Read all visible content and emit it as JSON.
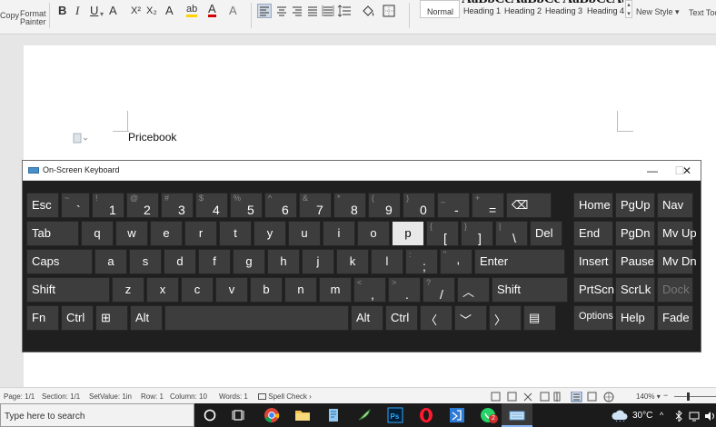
{
  "ribbon": {
    "copy": "Copy",
    "format_painter_1": "Format",
    "format_painter_2": "Painter",
    "fmt_bold": "B",
    "fmt_italic": "I",
    "fmt_underline": "U",
    "fmt_sub": "X₂",
    "fmt_sup": "X²",
    "fmt_font_color": "A",
    "styles": [
      "Normal",
      "Heading 1",
      "Heading 2",
      "Heading 3",
      "Heading 4"
    ],
    "styles_preview": "AaBbCcAaBbCc AaBbCcAaBbCc",
    "new_style": "New Style",
    "text_tool": "Text Too"
  },
  "document": {
    "text": "Pricebook"
  },
  "osk": {
    "title": "On-Screen Keyboard",
    "minimize": "—",
    "maximize": "☐",
    "close": "✕",
    "row1": [
      {
        "id": "esc",
        "main": "Esc"
      },
      {
        "id": "grave",
        "up": "~",
        "lo": "`"
      },
      {
        "id": "1",
        "up": "!",
        "lo": "1"
      },
      {
        "id": "2",
        "up": "@",
        "lo": "2"
      },
      {
        "id": "3",
        "up": "#",
        "lo": "3"
      },
      {
        "id": "4",
        "up": "$",
        "lo": "4"
      },
      {
        "id": "5",
        "up": "%",
        "lo": "5"
      },
      {
        "id": "6",
        "up": "^",
        "lo": "6"
      },
      {
        "id": "7",
        "up": "&",
        "lo": "7"
      },
      {
        "id": "8",
        "up": "*",
        "lo": "8"
      },
      {
        "id": "9",
        "up": "(",
        "lo": "9"
      },
      {
        "id": "0",
        "up": ")",
        "lo": "0"
      },
      {
        "id": "minus",
        "up": "_",
        "lo": "-"
      },
      {
        "id": "equals",
        "up": "+",
        "lo": "="
      },
      {
        "id": "backspace",
        "main": "⌫"
      },
      {
        "id": "home",
        "main": "Home"
      },
      {
        "id": "pgup",
        "main": "PgUp"
      },
      {
        "id": "nav",
        "main": "Nav"
      }
    ],
    "row2": [
      {
        "id": "tab",
        "main": "Tab"
      },
      {
        "id": "q",
        "main": "q"
      },
      {
        "id": "w",
        "main": "w"
      },
      {
        "id": "e",
        "main": "e"
      },
      {
        "id": "r",
        "main": "r"
      },
      {
        "id": "t",
        "main": "t"
      },
      {
        "id": "y",
        "main": "y"
      },
      {
        "id": "u",
        "main": "u"
      },
      {
        "id": "i",
        "main": "i"
      },
      {
        "id": "o",
        "main": "o"
      },
      {
        "id": "p",
        "main": "p"
      },
      {
        "id": "lbracket",
        "up": "{",
        "lo": "["
      },
      {
        "id": "rbracket",
        "up": "}",
        "lo": "]"
      },
      {
        "id": "backslash",
        "up": "|",
        "lo": "\\"
      },
      {
        "id": "del",
        "main": "Del"
      },
      {
        "id": "end",
        "main": "End"
      },
      {
        "id": "pgdn",
        "main": "PgDn"
      },
      {
        "id": "mvup",
        "main": "Mv Up"
      }
    ],
    "row3": [
      {
        "id": "caps",
        "main": "Caps"
      },
      {
        "id": "a",
        "main": "a"
      },
      {
        "id": "s",
        "main": "s"
      },
      {
        "id": "d",
        "main": "d"
      },
      {
        "id": "f",
        "main": "f"
      },
      {
        "id": "g",
        "main": "g"
      },
      {
        "id": "h",
        "main": "h"
      },
      {
        "id": "j",
        "main": "j"
      },
      {
        "id": "k",
        "main": "k"
      },
      {
        "id": "l",
        "main": "l"
      },
      {
        "id": "semicolon",
        "up": ":",
        "lo": ";"
      },
      {
        "id": "quote",
        "up": "\"",
        "lo": "'"
      },
      {
        "id": "enter",
        "main": "Enter"
      },
      {
        "id": "insert",
        "main": "Insert"
      },
      {
        "id": "pause",
        "main": "Pause"
      },
      {
        "id": "mvdn",
        "main": "Mv Dn"
      }
    ],
    "row4": [
      {
        "id": "shift-left",
        "main": "Shift"
      },
      {
        "id": "z",
        "main": "z"
      },
      {
        "id": "x",
        "main": "x"
      },
      {
        "id": "c",
        "main": "c"
      },
      {
        "id": "v",
        "main": "v"
      },
      {
        "id": "b",
        "main": "b"
      },
      {
        "id": "n",
        "main": "n"
      },
      {
        "id": "m",
        "main": "m"
      },
      {
        "id": "comma",
        "up": "<",
        "lo": ","
      },
      {
        "id": "period",
        "up": ">",
        "lo": "."
      },
      {
        "id": "slash",
        "up": "?",
        "lo": "/"
      },
      {
        "id": "arrow-up",
        "main": "︿"
      },
      {
        "id": "shift-right",
        "main": "Shift"
      },
      {
        "id": "prtscn",
        "main": "PrtScn"
      },
      {
        "id": "scrlk",
        "main": "ScrLk"
      },
      {
        "id": "dock",
        "main": "Dock"
      }
    ],
    "row5": [
      {
        "id": "fn",
        "main": "Fn"
      },
      {
        "id": "ctrl-left",
        "main": "Ctrl"
      },
      {
        "id": "win",
        "main": "⊞"
      },
      {
        "id": "alt-left",
        "main": "Alt"
      },
      {
        "id": "space",
        "main": ""
      },
      {
        "id": "alt-right",
        "main": "Alt"
      },
      {
        "id": "ctrl-right",
        "main": "Ctrl"
      },
      {
        "id": "arrow-left",
        "main": "〈"
      },
      {
        "id": "arrow-down",
        "main": "﹀"
      },
      {
        "id": "arrow-right",
        "main": "〉"
      },
      {
        "id": "menu",
        "main": "▤"
      },
      {
        "id": "options",
        "main": "Options"
      },
      {
        "id": "help",
        "main": "Help"
      },
      {
        "id": "fade",
        "main": "Fade"
      }
    ]
  },
  "status": {
    "page": "Page: 1/1",
    "section": "Section: 1/1",
    "setvalue": "SetValue: 1in",
    "row": "Row: 1",
    "column": "Column: 10",
    "words": "Words: 1",
    "spell": "Spell Check",
    "zoom": "140%"
  },
  "taskbar": {
    "search_placeholder": "Type here to search",
    "temp": "30°C",
    "badge": "2"
  },
  "colors": {
    "osk_bg": "#1f1f1f",
    "key_bg": "#3d3d3d",
    "key_highlight": "#e8e8e8",
    "taskbar_bg": "#1b1b1b"
  }
}
